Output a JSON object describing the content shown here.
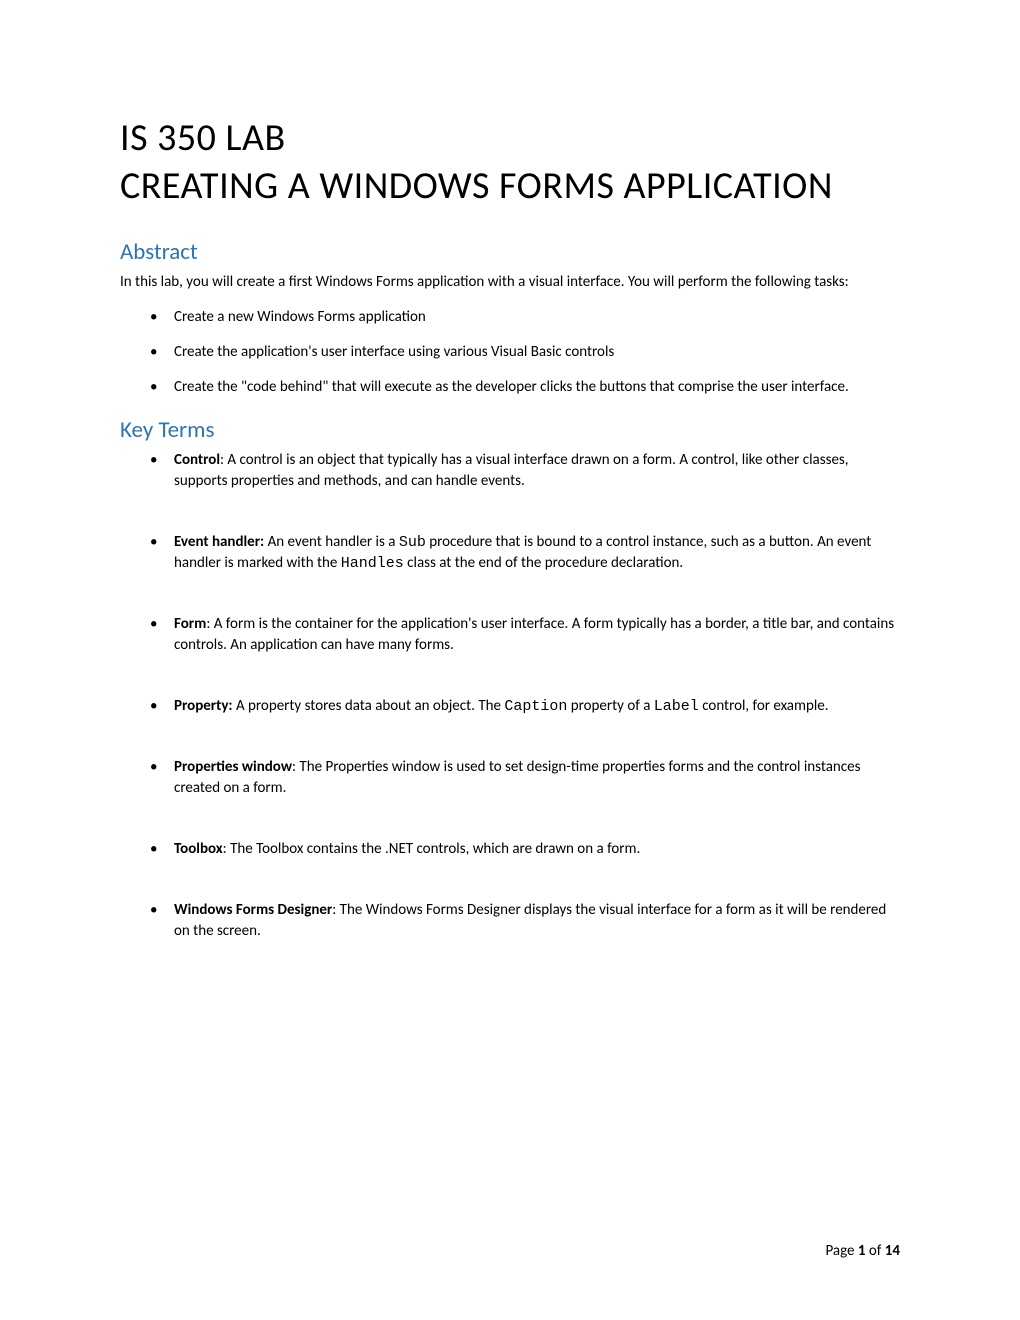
{
  "title": {
    "line1": "IS 350 LAB",
    "line2": "CREATING A WINDOWS FORMS APPLICATION"
  },
  "abstract": {
    "heading": "Abstract",
    "intro": "In this lab, you will create a first Windows Forms application with a visual interface. You will perform the following tasks:",
    "tasks": [
      "Create a new Windows Forms application",
      "Create the application's user interface using various Visual Basic controls",
      "Create the \"code behind\" that will execute as the developer clicks the buttons that comprise the user interface."
    ]
  },
  "keyTerms": {
    "heading": "Key Terms",
    "terms": [
      {
        "name": "Control",
        "colon": ": ",
        "desc": "A control is an object that typically has a visual interface drawn on a form. A control, like other classes, supports properties and methods, and can handle events."
      },
      {
        "name": "Event handler:",
        "colon": " ",
        "pre": "An event handler is a ",
        "code1": "Sub",
        "mid": " procedure that is bound to a control instance, such as a button. An event handler is marked with the ",
        "code2": "Handles",
        "post": " class at the end of the procedure declaration."
      },
      {
        "name": "Form",
        "colon": ": ",
        "desc": "A form is the container for the application's user interface. A form typically has a border, a title bar, and contains controls. An application can have many forms."
      },
      {
        "name": "Property:",
        "colon": " ",
        "pre": "A property stores data about an object. The ",
        "code1": "Caption",
        "mid": " property of a ",
        "code2": "Label",
        "post": " control, for example."
      },
      {
        "name": "Properties window",
        "colon": ": ",
        "desc": "The Properties window is used to set design-time properties forms and the control instances created on a form."
      },
      {
        "name": "Toolbox",
        "colon": ": ",
        "desc": "The Toolbox contains the .NET controls, which are drawn on a form."
      },
      {
        "name": "Windows Forms Designer",
        "colon": ": ",
        "desc": "The Windows Forms Designer displays the visual interface for a form as it will be rendered on the screen."
      }
    ]
  },
  "footer": {
    "pageLabel": "Page ",
    "current": "1",
    "of": " of ",
    "total": "14"
  }
}
